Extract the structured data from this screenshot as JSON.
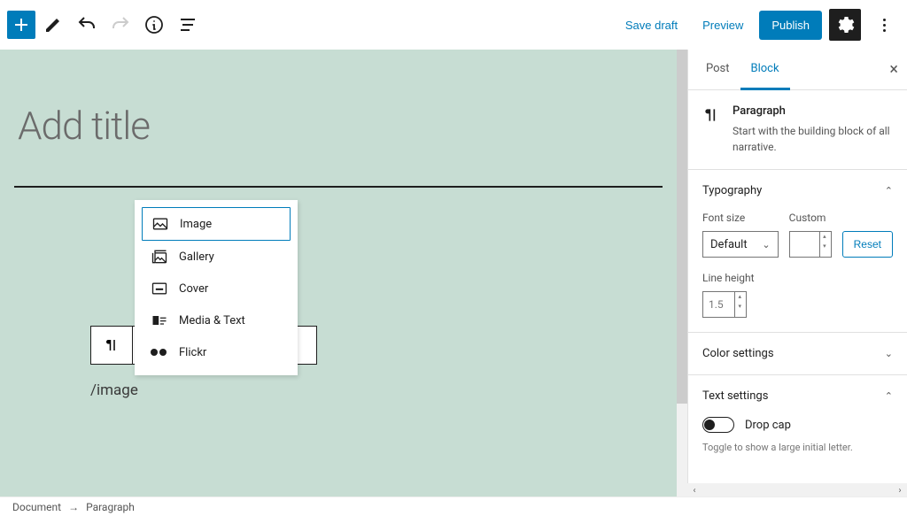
{
  "toolbar": {
    "save_draft": "Save draft",
    "preview": "Preview",
    "publish": "Publish"
  },
  "editor": {
    "title_placeholder": "Add title",
    "slash_command": "/image"
  },
  "inserter": {
    "items": [
      {
        "label": "Image",
        "icon": "image-icon",
        "selected": true
      },
      {
        "label": "Gallery",
        "icon": "gallery-icon",
        "selected": false
      },
      {
        "label": "Cover",
        "icon": "cover-icon",
        "selected": false
      },
      {
        "label": "Media & Text",
        "icon": "media-text-icon",
        "selected": false
      },
      {
        "label": "Flickr",
        "icon": "flickr-icon",
        "selected": false
      }
    ]
  },
  "sidebar": {
    "tabs": {
      "post": "Post",
      "block": "Block"
    },
    "block_info": {
      "title": "Paragraph",
      "desc": "Start with the building block of all narrative."
    },
    "typography": {
      "title": "Typography",
      "font_size_label": "Font size",
      "font_size_value": "Default",
      "custom_label": "Custom",
      "custom_value": "",
      "reset": "Reset",
      "line_height_label": "Line height",
      "line_height_value": "1.5"
    },
    "color": {
      "title": "Color settings"
    },
    "text": {
      "title": "Text settings",
      "drop_cap": "Drop cap",
      "help": "Toggle to show a large initial letter."
    }
  },
  "breadcrumb": {
    "item1": "Document",
    "item2": "Paragraph"
  }
}
